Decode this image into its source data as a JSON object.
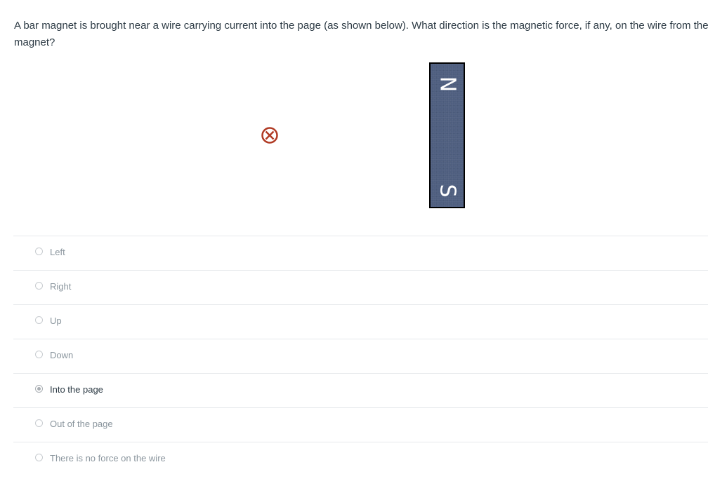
{
  "question": {
    "text": "A bar magnet is brought near a wire carrying current into the page (as shown below). What direction is the magnetic force, if any, on the wire from the magnet?"
  },
  "figure": {
    "wire_icon": "current-into-page-icon",
    "magnet": {
      "north_label": "N",
      "south_label": "S",
      "color": "#4f5f80"
    },
    "wire_color": "#b03a24"
  },
  "answers": [
    {
      "label": "Left",
      "selected": false
    },
    {
      "label": "Right",
      "selected": false
    },
    {
      "label": "Up",
      "selected": false
    },
    {
      "label": "Down",
      "selected": false
    },
    {
      "label": "Into the page",
      "selected": true
    },
    {
      "label": "Out of the page",
      "selected": false
    },
    {
      "label": "There is no force on the wire",
      "selected": false
    }
  ]
}
